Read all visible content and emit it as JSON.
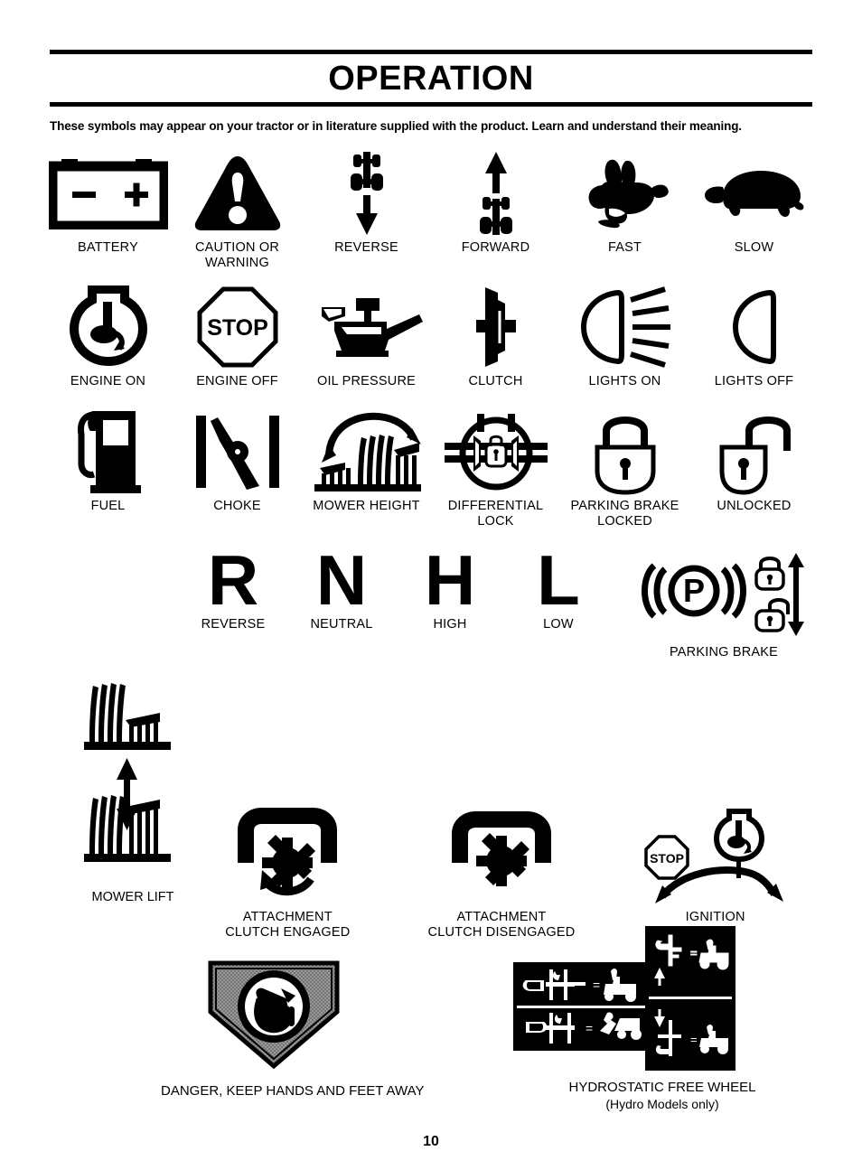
{
  "header": {
    "title": "OPERATION",
    "intro": "These symbols may appear on your tractor or in literature supplied with the product.  Learn and understand their meaning."
  },
  "symbols_row1": [
    {
      "icon": "battery-icon",
      "label": "BATTERY"
    },
    {
      "icon": "warning-triangle-icon",
      "label": "CAUTION OR\nWARNING"
    },
    {
      "icon": "reverse-tractor-icon",
      "label": "REVERSE"
    },
    {
      "icon": "forward-tractor-icon",
      "label": "FORWARD"
    },
    {
      "icon": "rabbit-icon",
      "label": "FAST"
    },
    {
      "icon": "turtle-icon",
      "label": "SLOW"
    }
  ],
  "symbols_row2": [
    {
      "icon": "engine-on-icon",
      "label": "ENGINE ON"
    },
    {
      "icon": "stop-octagon-icon",
      "label": "ENGINE OFF"
    },
    {
      "icon": "oil-can-icon",
      "label": "OIL PRESSURE"
    },
    {
      "icon": "clutch-icon",
      "label": "CLUTCH"
    },
    {
      "icon": "lights-on-icon",
      "label": "LIGHTS ON"
    },
    {
      "icon": "lights-off-icon",
      "label": "LIGHTS OFF"
    }
  ],
  "symbols_row3": [
    {
      "icon": "fuel-pump-icon",
      "label": "FUEL"
    },
    {
      "icon": "choke-icon",
      "label": "CHOKE"
    },
    {
      "icon": "mower-height-icon",
      "label": "MOWER HEIGHT"
    },
    {
      "icon": "differential-lock-icon",
      "label": "DIFFERENTIAL\nLOCK"
    },
    {
      "icon": "padlock-closed-icon",
      "label": "PARKING BRAKE\nLOCKED"
    },
    {
      "icon": "padlock-open-icon",
      "label": "UNLOCKED"
    }
  ],
  "gear_row": {
    "letters": [
      {
        "glyph": "R",
        "label": "REVERSE"
      },
      {
        "glyph": "N",
        "label": "NEUTRAL"
      },
      {
        "glyph": "H",
        "label": "HIGH"
      },
      {
        "glyph": "L",
        "label": "LOW"
      }
    ],
    "parking_brake": {
      "icon": "parking-brake-p-icon",
      "label": "PARKING BRAKE"
    }
  },
  "mower_lift": {
    "icon": "mower-lift-icon",
    "label": "MOWER LIFT"
  },
  "attachments": [
    {
      "icon": "attachment-clutch-engaged-icon",
      "label": "ATTACHMENT\nCLUTCH ENGAGED"
    },
    {
      "icon": "attachment-clutch-disengaged-icon",
      "label": "ATTACHMENT\nCLUTCH DISENGAGED"
    },
    {
      "icon": "ignition-switch-icon",
      "label": "IGNITION"
    }
  ],
  "danger": {
    "icon": "danger-hands-feet-icon",
    "label": "DANGER, KEEP HANDS AND FEET AWAY"
  },
  "hydrostatic": {
    "icon": "hydrostatic-free-wheel-decal",
    "label": "HYDROSTATIC FREE WHEEL",
    "sublabel": "(Hydro Models only)"
  },
  "page_number": "10",
  "colors": {
    "ink": "#000000",
    "paper": "#ffffff",
    "danger_fill": "#6f6f6f"
  }
}
